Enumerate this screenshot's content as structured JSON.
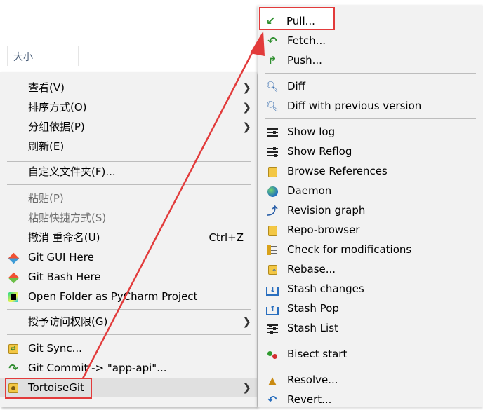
{
  "explorer": {
    "column_size_label": "大小"
  },
  "context_menu": {
    "items": [
      {
        "label": "查看(V)",
        "submenu": true
      },
      {
        "label": "排序方式(O)",
        "submenu": true
      },
      {
        "label": "分组依据(P)",
        "submenu": true
      },
      {
        "label": "刷新(E)"
      },
      {
        "label": "自定义文件夹(F)..."
      },
      {
        "label": "粘贴(P)",
        "disabled": true
      },
      {
        "label": "粘贴快捷方式(S)",
        "disabled": true
      },
      {
        "label": "撤消 重命名(U)",
        "shortcut": "Ctrl+Z"
      },
      {
        "label": "Git GUI Here",
        "icon": "git-gui-icon"
      },
      {
        "label": "Git Bash Here",
        "icon": "git-bash-icon"
      },
      {
        "label": "Open Folder as PyCharm Project",
        "icon": "pycharm-icon"
      },
      {
        "label": "授予访问权限(G)",
        "submenu": true
      },
      {
        "label": "Git Sync...",
        "icon": "git-sync-icon"
      },
      {
        "label": "Git Commit -> \"app-api\"...",
        "icon": "git-commit-icon"
      },
      {
        "label": "TortoiseGit",
        "icon": "tortoisegit-icon",
        "submenu": true,
        "active": true
      }
    ]
  },
  "submenu": {
    "items": [
      {
        "label": "Pull...",
        "icon": "pull-icon",
        "highlighted": true
      },
      {
        "label": "Fetch...",
        "icon": "fetch-icon"
      },
      {
        "label": "Push...",
        "icon": "push-icon"
      },
      {
        "label": "Diff",
        "icon": "diff-icon"
      },
      {
        "label": "Diff with previous version",
        "icon": "diff-prev-icon"
      },
      {
        "label": "Show log",
        "icon": "log-icon"
      },
      {
        "label": "Show Reflog",
        "icon": "reflog-icon"
      },
      {
        "label": "Browse References",
        "icon": "browse-refs-icon"
      },
      {
        "label": "Daemon",
        "icon": "daemon-globe-icon"
      },
      {
        "label": "Revision graph",
        "icon": "revision-graph-icon"
      },
      {
        "label": "Repo-browser",
        "icon": "repo-browser-icon"
      },
      {
        "label": "Check for modifications",
        "icon": "check-mods-icon"
      },
      {
        "label": "Rebase...",
        "icon": "rebase-icon"
      },
      {
        "label": "Stash changes",
        "icon": "stash-changes-icon"
      },
      {
        "label": "Stash Pop",
        "icon": "stash-pop-icon"
      },
      {
        "label": "Stash List",
        "icon": "stash-list-icon"
      },
      {
        "label": "Bisect start",
        "icon": "bisect-icon"
      },
      {
        "label": "Resolve...",
        "icon": "resolve-icon"
      },
      {
        "label": "Revert...",
        "icon": "revert-icon"
      }
    ]
  },
  "colors": {
    "menu_bg": "#f2f2f2",
    "highlight_border": "#e23b3b",
    "annotation_arrow": "#e23b3b",
    "disabled_text": "#6d6d6d"
  }
}
